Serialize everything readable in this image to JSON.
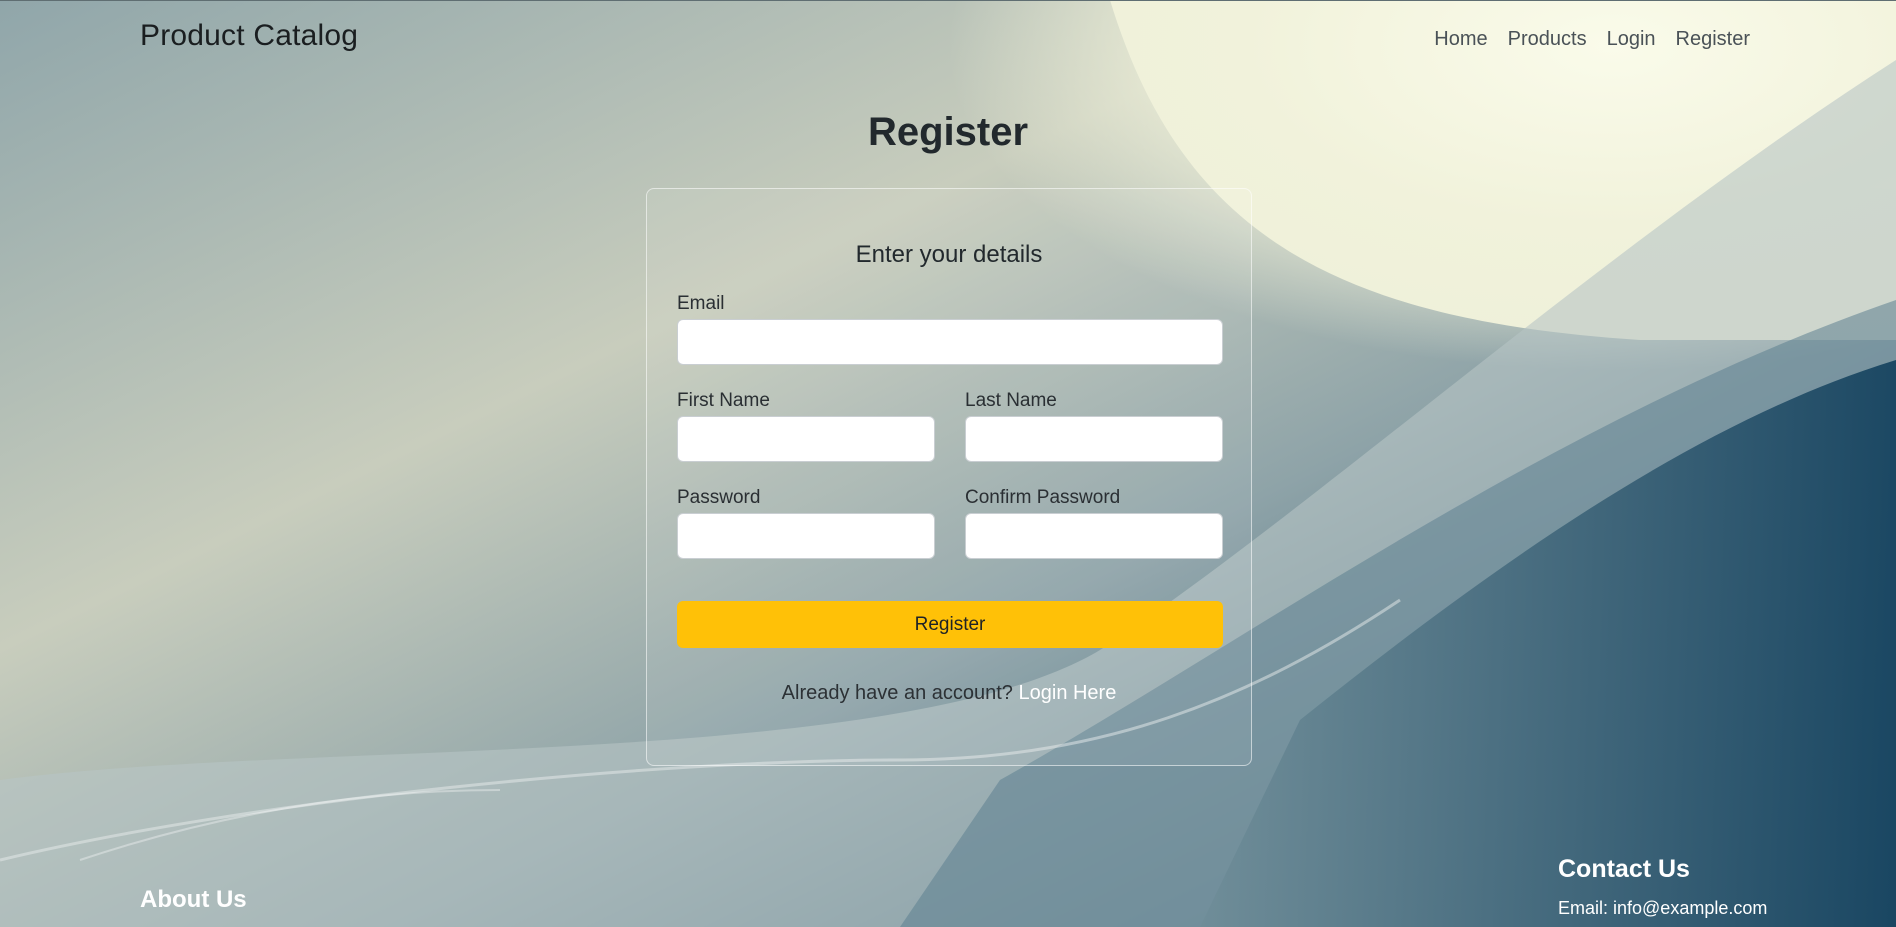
{
  "navbar": {
    "brand": "Product Catalog",
    "links": [
      "Home",
      "Products",
      "Login",
      "Register"
    ]
  },
  "page": {
    "title": "Register"
  },
  "form": {
    "heading": "Enter your details",
    "email_label": "Email",
    "email_value": "",
    "first_name_label": "First Name",
    "first_name_value": "",
    "last_name_label": "Last Name",
    "last_name_value": "",
    "password_label": "Password",
    "password_value": "",
    "confirm_password_label": "Confirm Password",
    "confirm_password_value": "",
    "submit_label": "Register",
    "login_prompt": "Already have an account?",
    "login_link": "Login Here"
  },
  "footer": {
    "about_title": "About Us",
    "contact_title": "Contact Us",
    "contact_email": "Email: info@example.com"
  },
  "colors": {
    "accent": "#ffc107",
    "background_dark": "#0e4565",
    "background_light": "#cfd4c2",
    "highlight": "#f7f8e6"
  }
}
